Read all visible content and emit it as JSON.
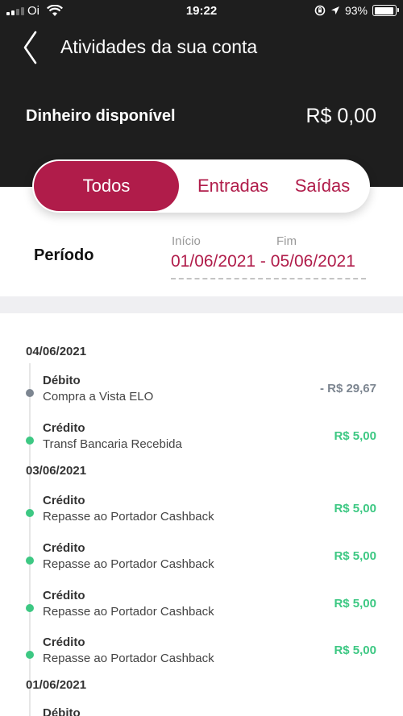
{
  "status_bar": {
    "carrier": "Oi",
    "time": "19:22",
    "battery": "93%"
  },
  "header": {
    "title": "Atividades da sua conta",
    "balance_label": "Dinheiro disponível",
    "balance_value": "R$ 0,00"
  },
  "tabs": [
    {
      "label": "Todos",
      "active": true
    },
    {
      "label": "Entradas",
      "active": false
    },
    {
      "label": "Saídas",
      "active": false
    }
  ],
  "period": {
    "label": "Período",
    "start_label": "Início",
    "end_label": "Fim",
    "range": "01/06/2021 - 05/06/2021"
  },
  "groups": [
    {
      "date": "04/06/2021",
      "transactions": [
        {
          "type": "Débito",
          "description": "Compra a Vista ELO",
          "amount": "- R$ 29,67",
          "kind": "debit"
        },
        {
          "type": "Crédito",
          "description": "Transf Bancaria Recebida",
          "amount": "R$ 5,00",
          "kind": "credit"
        }
      ]
    },
    {
      "date": "03/06/2021",
      "transactions": [
        {
          "type": "Crédito",
          "description": "Repasse ao Portador Cashback",
          "amount": "R$ 5,00",
          "kind": "credit"
        },
        {
          "type": "Crédito",
          "description": "Repasse ao Portador Cashback",
          "amount": "R$ 5,00",
          "kind": "credit"
        },
        {
          "type": "Crédito",
          "description": "Repasse ao Portador Cashback",
          "amount": "R$ 5,00",
          "kind": "credit"
        },
        {
          "type": "Crédito",
          "description": "Repasse ao Portador Cashback",
          "amount": "R$ 5,00",
          "kind": "credit"
        }
      ]
    },
    {
      "date": "01/06/2021",
      "transactions": [
        {
          "type": "Débito",
          "description": "",
          "amount": "",
          "kind": "debit"
        }
      ]
    }
  ],
  "colors": {
    "accent": "#b01c4a",
    "header_bg": "#1e1e1e",
    "credit": "#3dc883",
    "debit": "#7d8691"
  }
}
